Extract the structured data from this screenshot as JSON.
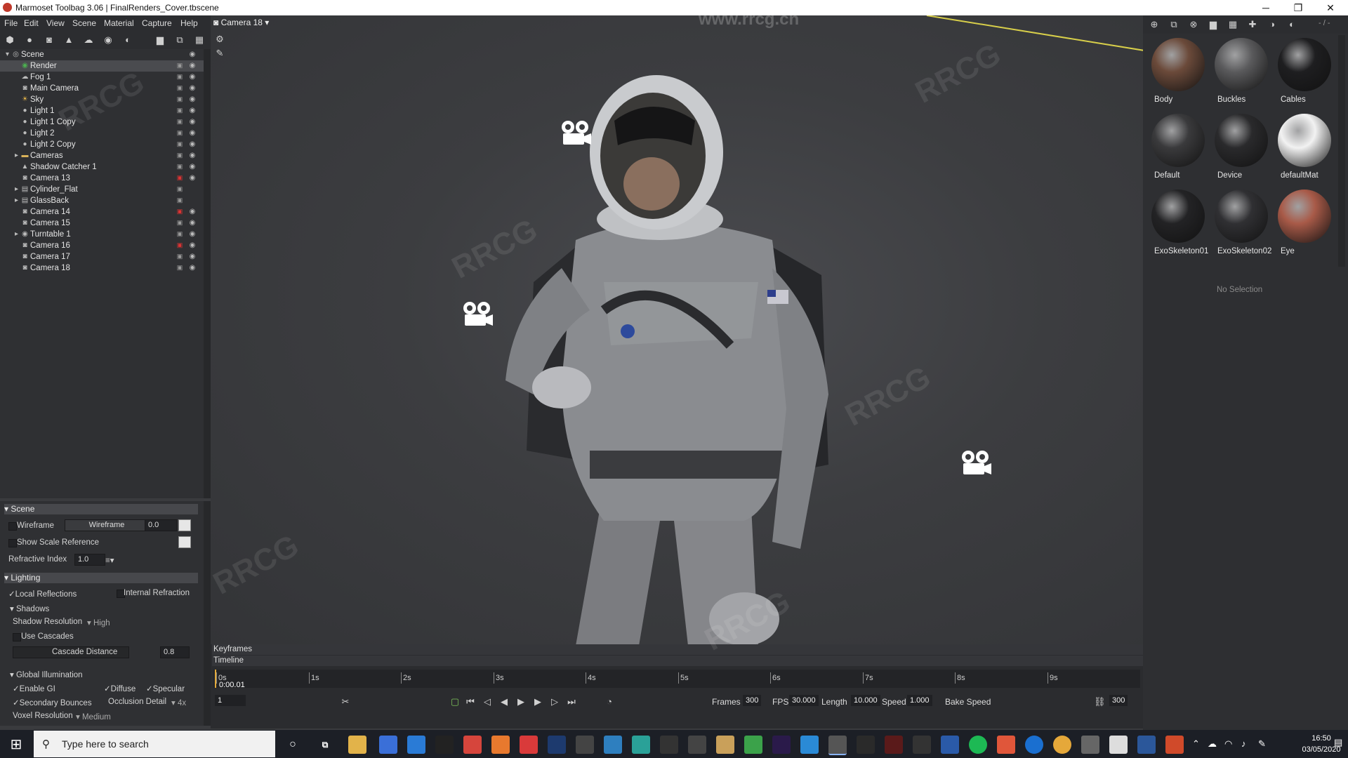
{
  "window": {
    "title": "Marmoset Toolbag 3.06  |  FinalRenders_Cover.tbscene",
    "minimize": "─",
    "restore": "❐",
    "close": "✕"
  },
  "menu": [
    "File",
    "Edit",
    "View",
    "Scene",
    "Material",
    "Capture",
    "Help"
  ],
  "viewport": {
    "camera_label": "Camera 18 ▾",
    "watermark_url": "www.rrcg.cn"
  },
  "outliner": {
    "items": [
      {
        "label": "Scene"
      },
      {
        "label": "Render"
      },
      {
        "label": "Fog 1"
      },
      {
        "label": "Main Camera"
      },
      {
        "label": "Sky"
      },
      {
        "label": "Light 1"
      },
      {
        "label": "Light 1 Copy"
      },
      {
        "label": "Light 2"
      },
      {
        "label": "Light 2 Copy"
      },
      {
        "label": "Cameras"
      },
      {
        "label": "Shadow Catcher 1"
      },
      {
        "label": "Camera 13"
      },
      {
        "label": "Cylinder_Flat"
      },
      {
        "label": "GlassBack"
      },
      {
        "label": "Camera 14"
      },
      {
        "label": "Camera 15"
      },
      {
        "label": "Turntable 1"
      },
      {
        "label": "Camera 16"
      },
      {
        "label": "Camera 17"
      },
      {
        "label": "Camera 18"
      }
    ]
  },
  "props": {
    "scene_header": "Scene",
    "wireframe": "Wireframe",
    "wireframe_btn": "Wireframe",
    "wireframe_val": "0.0",
    "scale_ref": "Show Scale Reference",
    "refr_index": "Refractive Index",
    "refr_index_val": "1.0",
    "lighting_header": "Lighting",
    "local_refl": "Local Reflections",
    "internal_refr": "Internal Refraction",
    "shadows": "Shadows",
    "shadow_res": "Shadow Resolution",
    "shadow_res_val": "High",
    "use_cascades": "Use Cascades",
    "cascade_dist": "Cascade Distance",
    "cascade_val": "0.8",
    "gi_header": "Global Illumination",
    "enable_gi": "Enable GI",
    "diffuse": "Diffuse",
    "specular": "Specular",
    "sec_bounces": "Secondary Bounces",
    "occ_detail": "Occlusion Detail",
    "occ_val": "4x",
    "voxel_res": "Voxel Resolution",
    "voxel_val": "Medium"
  },
  "timeline": {
    "keyframes": "Keyframes",
    "timeline": "Timeline",
    "current_time": "0:00.01",
    "ticks": [
      "0s",
      "1s",
      "2s",
      "3s",
      "4s",
      "5s",
      "6s",
      "7s",
      "8s",
      "9s"
    ],
    "frame_field": "1",
    "frames_label": "Frames",
    "frames_val": "300",
    "fps_label": "FPS",
    "fps_val": "30.000",
    "length_label": "Length",
    "length_val": "10.000",
    "speed_label": "Speed",
    "speed_val": "1.000",
    "bake_label": "Bake Speed",
    "end_frame": "300"
  },
  "materials": {
    "items": [
      {
        "name": "Body",
        "color": "#6b4a3a"
      },
      {
        "name": "Buckles",
        "color": "#5a5a5c"
      },
      {
        "name": "Cables",
        "color": "#1e1e20"
      },
      {
        "name": "Default",
        "color": "#3a3a3c"
      },
      {
        "name": "Device",
        "color": "#2a2a2c"
      },
      {
        "name": "defaultMat",
        "color": "#f2f2f2"
      },
      {
        "name": "ExoSkeleton01",
        "color": "#232325"
      },
      {
        "name": "ExoSkeleton02",
        "color": "#303033"
      },
      {
        "name": "Eye",
        "color": "#a85a48"
      }
    ],
    "no_selection": "No Selection",
    "top_label": "- / -"
  },
  "taskbar": {
    "search_placeholder": "Type here to search",
    "time": "16:50",
    "date": "03/05/2020"
  },
  "colors": {
    "accent": "#c0392b",
    "lock_red": "#d33333"
  }
}
